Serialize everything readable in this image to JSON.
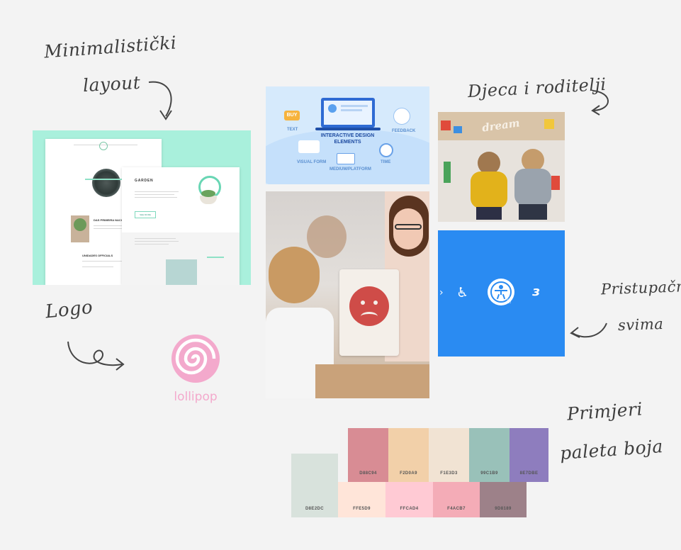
{
  "annotations": {
    "minimal_layout": [
      "Minimalistički",
      "layout"
    ],
    "kids_parents": "Djeca i roditelji",
    "logo": "Logo",
    "accessible": [
      "Pristupačno",
      "svima"
    ],
    "palettes": [
      "Primjeri",
      "paleta boja"
    ]
  },
  "logo": {
    "brand_name": "lollipop",
    "color": "#f3a9cc"
  },
  "interactive_card": {
    "title": [
      "INTERACTIVE DESIGN",
      "ELEMENTS"
    ],
    "labels": {
      "text": "TEXT",
      "buy": "BUY",
      "feedback": "FEEDBACK",
      "visual_form": "VISUAL FORM",
      "medium_platform": "MEDIUM/PLATFORM",
      "time": "TIME"
    }
  },
  "kids_photo": {
    "sign_text": "dream"
  },
  "accessibility_card": {
    "background": "#2a8bf2"
  },
  "palette_top": [
    {
      "code": "D88C94",
      "color": "#d88c94"
    },
    {
      "code": "F2D0A9",
      "color": "#f2d0a9"
    },
    {
      "code": "F1E3D3",
      "color": "#f1e3d3"
    },
    {
      "code": "99C1B9",
      "color": "#99c1b9"
    },
    {
      "code": "8E7DBE",
      "color": "#8e7dbe"
    }
  ],
  "palette_bottom": [
    {
      "code": "D8E2DC",
      "color": "#d8e2dc"
    },
    {
      "code": "FFE5D9",
      "color": "#ffe5d9"
    },
    {
      "code": "FFCAD4",
      "color": "#ffcad4"
    },
    {
      "code": "F4ACB7",
      "color": "#f4acb7"
    },
    {
      "code": "9D8189",
      "color": "#9d8189"
    }
  ],
  "layout_mock": {
    "hero_title": "DAS PRIMEIRA NACIONAL",
    "section_title": "GARDEN",
    "sub_title": "UNIDADES OFFICIALS",
    "button_label": "SEE MORE"
  }
}
